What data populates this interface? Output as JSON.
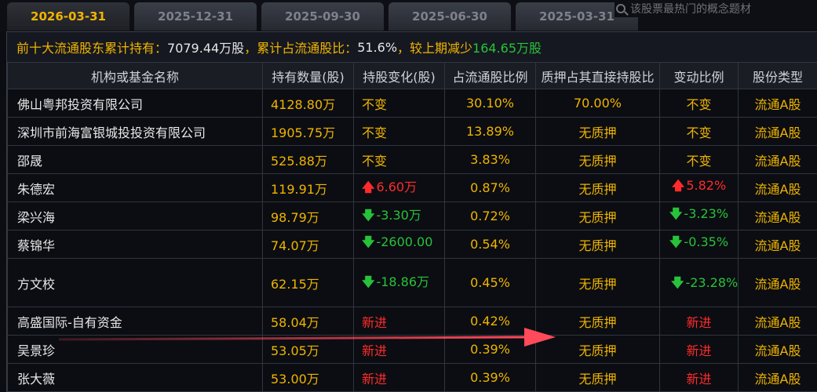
{
  "tabs": [
    {
      "label": "2026-03-31",
      "active": true
    },
    {
      "label": "2025-12-31",
      "active": false
    },
    {
      "label": "2025-09-30",
      "active": false
    },
    {
      "label": "2025-06-30",
      "active": false
    },
    {
      "label": "2025-03-31",
      "active": false
    }
  ],
  "search": {
    "placeholder": "该股票最热门的概念题材"
  },
  "summary": {
    "prefix": "前十大流通股东累计持有：",
    "total": "7079.44万股",
    "ratio_label": "，累计占流通股比：",
    "ratio": "51.6%",
    "change_label": "，较上期减少",
    "change": "164.65万股"
  },
  "table": {
    "headers": [
      "机构或基金名称",
      "持有数量(股)",
      "持股变化(股)",
      "占流通股比例",
      "质押占其直接持股比",
      "变动比例",
      "股份类型"
    ],
    "rows": [
      {
        "name": "佛山粤邦投资有限公司",
        "shares": "4128.80万",
        "change": "不变",
        "change_dir": "same",
        "ratio": "30.10%",
        "pledge": "70.00%",
        "chg_ratio": "不变",
        "chg_dir": "same",
        "type": "流通A股"
      },
      {
        "name": "深圳市前海富银城投投资有限公司",
        "shares": "1905.75万",
        "change": "不变",
        "change_dir": "same",
        "ratio": "13.89%",
        "pledge": "无质押",
        "chg_ratio": "不变",
        "chg_dir": "same",
        "type": "流通A股"
      },
      {
        "name": "邵晟",
        "shares": "525.88万",
        "change": "不变",
        "change_dir": "same",
        "ratio": "3.83%",
        "pledge": "无质押",
        "chg_ratio": "不变",
        "chg_dir": "same",
        "type": "流通A股"
      },
      {
        "name": "朱德宏",
        "shares": "119.91万",
        "change": "6.60万",
        "change_dir": "up",
        "ratio": "0.87%",
        "pledge": "无质押",
        "chg_ratio": "5.82%",
        "chg_dir": "up",
        "type": "流通A股"
      },
      {
        "name": "梁兴海",
        "shares": "98.79万",
        "change": "-3.30万",
        "change_dir": "down",
        "ratio": "0.72%",
        "pledge": "无质押",
        "chg_ratio": "-3.23%",
        "chg_dir": "down",
        "type": "流通A股"
      },
      {
        "name": "蔡锦华",
        "shares": "74.07万",
        "change": "-2600.00",
        "change_dir": "down",
        "ratio": "0.54%",
        "pledge": "无质押",
        "chg_ratio": "-0.35%",
        "chg_dir": "down",
        "type": "流通A股"
      },
      {
        "name": "方文校",
        "shares": "62.15万",
        "change": "-18.86万",
        "change_dir": "down",
        "ratio": "0.45%",
        "pledge": "无质押",
        "chg_ratio": "-23.28%",
        "chg_dir": "down",
        "type": "流通A股",
        "tall": true
      },
      {
        "name": "高盛国际-自有资金",
        "shares": "58.04万",
        "change": "新进",
        "change_dir": "new",
        "ratio": "0.42%",
        "pledge": "无质押",
        "chg_ratio": "新进",
        "chg_dir": "new",
        "type": "流通A股"
      },
      {
        "name": "吴景珍",
        "shares": "53.05万",
        "change": "新进",
        "change_dir": "new",
        "ratio": "0.39%",
        "pledge": "无质押",
        "chg_ratio": "新进",
        "chg_dir": "new",
        "type": "流通A股"
      },
      {
        "name": "张大薇",
        "shares": "53.00万",
        "change": "新进",
        "change_dir": "new",
        "ratio": "0.39%",
        "pledge": "无质押",
        "chg_ratio": "新进",
        "chg_dir": "new",
        "type": "流通A股"
      }
    ]
  },
  "colors": {
    "accent": "#f0b400",
    "up": "#ff2b2b",
    "down": "#28c23a",
    "annotation_arrow": "#ff4a5a"
  }
}
